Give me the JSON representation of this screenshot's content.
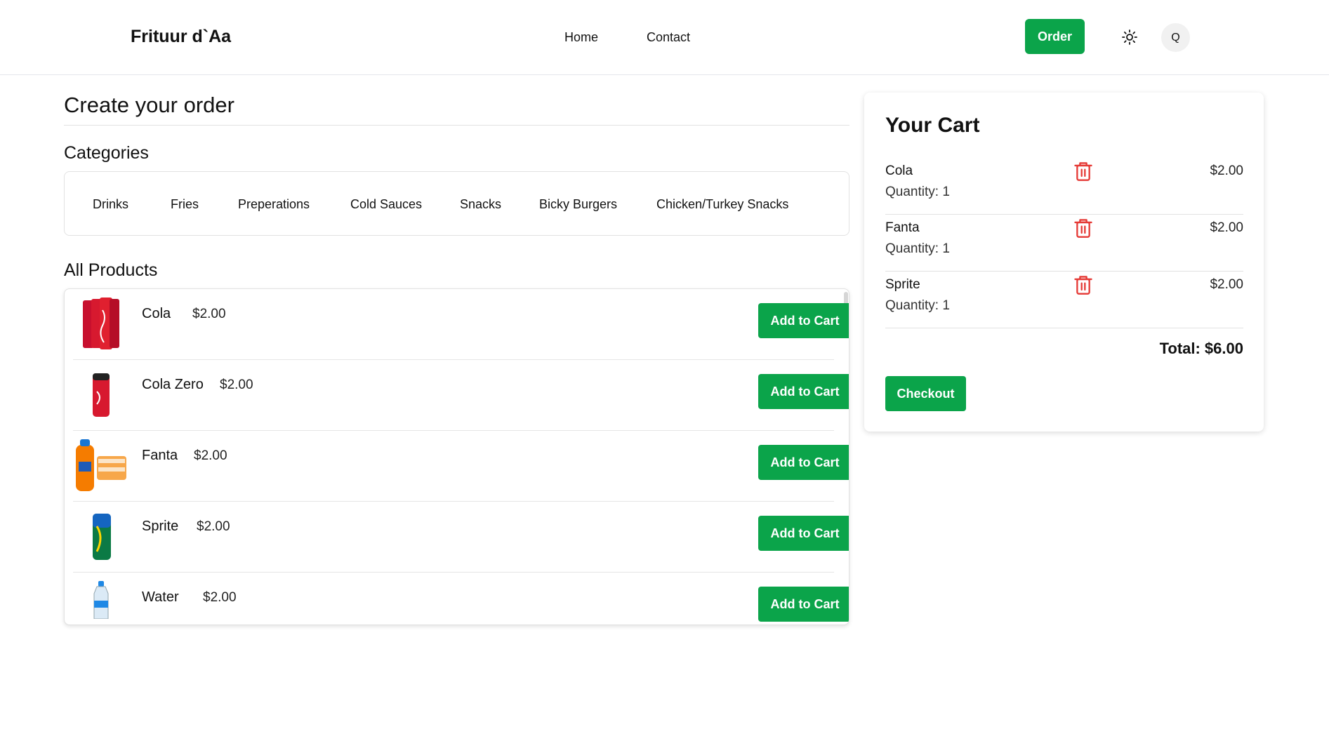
{
  "header": {
    "brand": "Frituur d`Aa",
    "nav": {
      "home": "Home",
      "contact": "Contact"
    },
    "order_label": "Order",
    "theme_icon": "sun-icon",
    "avatar_letter": "Q"
  },
  "main": {
    "title": "Create your order",
    "categories_heading": "Categories",
    "categories": [
      "Drinks",
      "Fries",
      "Preperations",
      "Cold Sauces",
      "Snacks",
      "Bicky Burgers",
      "Chicken/Turkey Snacks"
    ],
    "products_heading": "All Products",
    "add_label": "Add to Cart",
    "products": [
      {
        "name": "Cola",
        "price": "$2.00"
      },
      {
        "name": "Cola Zero",
        "price": "$2.00"
      },
      {
        "name": "Fanta",
        "price": "$2.00"
      },
      {
        "name": "Sprite",
        "price": "$2.00"
      },
      {
        "name": "Water",
        "price": "$2.00"
      }
    ]
  },
  "cart": {
    "title": "Your Cart",
    "quantity_label": "Quantity:",
    "items": [
      {
        "name": "Cola",
        "quantity": "1",
        "price": "$2.00"
      },
      {
        "name": "Fanta",
        "quantity": "1",
        "price": "$2.00"
      },
      {
        "name": "Sprite",
        "quantity": "1",
        "price": "$2.00"
      }
    ],
    "total": "Total: $6.00",
    "checkout_label": "Checkout"
  },
  "colors": {
    "accent_green": "#0ba44a",
    "trash_red": "#e53935",
    "border": "#e2e2e2"
  }
}
